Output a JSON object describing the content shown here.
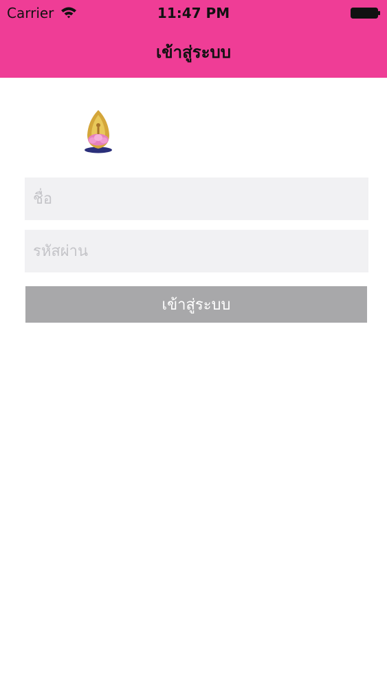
{
  "status_bar": {
    "carrier": "Carrier",
    "time": "11:47 PM",
    "wifi_icon": "wifi-icon",
    "battery_icon": "battery-icon"
  },
  "nav": {
    "title": "เข้าสู่ระบบ"
  },
  "logo": {
    "icon": "royal-emblem-logo"
  },
  "form": {
    "username_placeholder": "ชื่อ",
    "username_value": "",
    "password_placeholder": "รหัสผ่าน",
    "password_value": "",
    "login_label": "เข้าสู่ระบบ"
  },
  "colors": {
    "header": "#ef3d96",
    "field_bg": "#f1f1f3",
    "button_bg": "#a8a8aa",
    "button_text": "#ffffff"
  }
}
